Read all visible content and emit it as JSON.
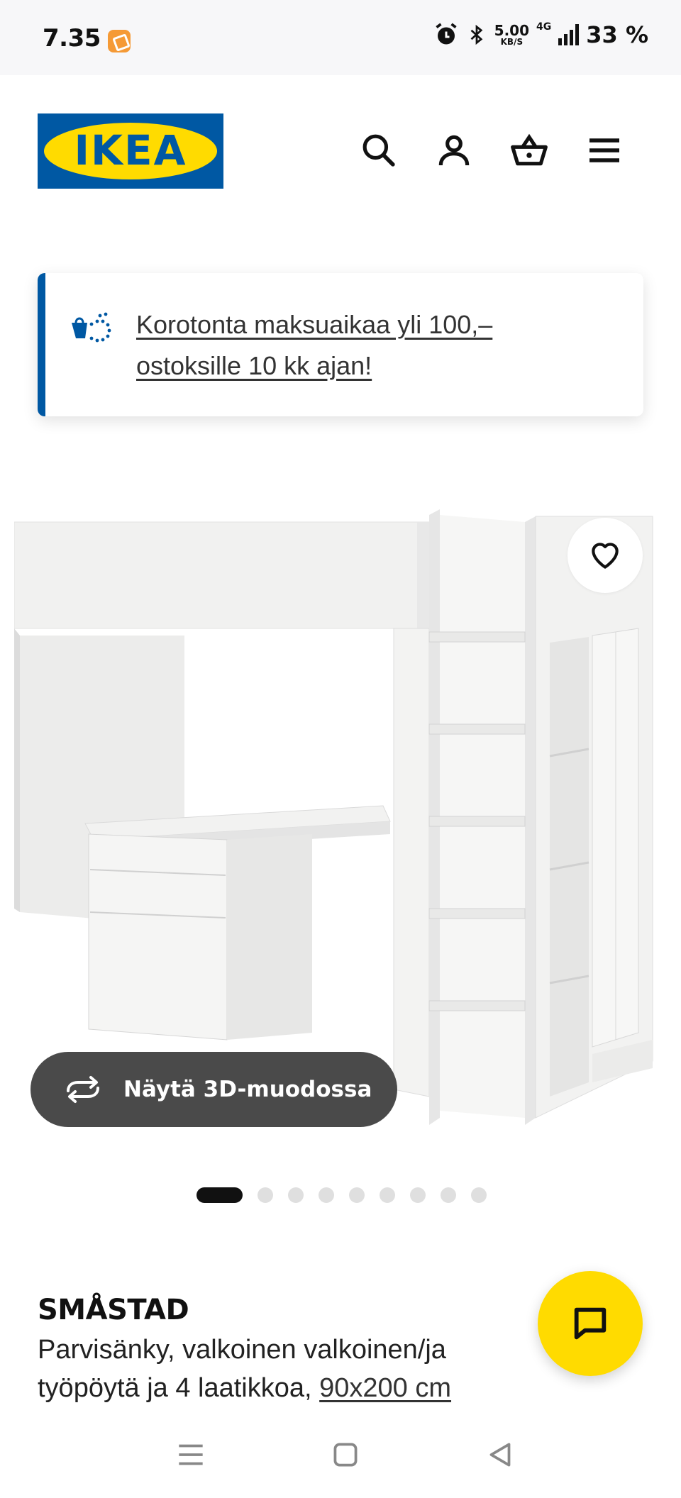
{
  "status_bar": {
    "time": "7.35",
    "net_speed_value": "5.00",
    "net_speed_unit": "KB/S",
    "network_type": "4G",
    "battery": "33 %"
  },
  "header": {
    "logo_text": "IKEA",
    "brand_colors": {
      "blue": "#0058a3",
      "yellow": "#ffdb00"
    },
    "icons": [
      "search-icon",
      "account-icon",
      "cart-icon",
      "menu-icon"
    ]
  },
  "promo": {
    "text": "Korotonta maksuaikaa yli 100,– ostoksille 10 kk ajan!"
  },
  "gallery": {
    "view_3d_label": "Näytä 3D-muodossa",
    "total_images": 10,
    "active_index": 0
  },
  "product": {
    "name": "SMÅSTAD",
    "description": "Parvisänky, valkoinen valkoinen/ja työpöytä ja 4 laatikkoa,",
    "size": "90x200 cm"
  }
}
